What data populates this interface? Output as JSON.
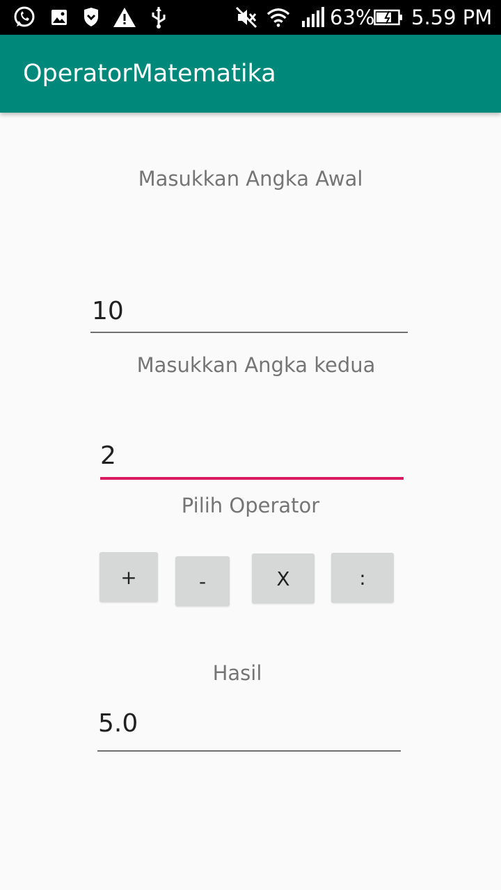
{
  "status_bar": {
    "battery_percent": "63%",
    "time": "5.59 PM",
    "icons": [
      "whatsapp-icon",
      "image-icon",
      "shield-icon",
      "warning-icon",
      "usb-icon",
      "mute-icon",
      "wifi-icon",
      "signal-icon",
      "battery-icon"
    ]
  },
  "app_bar": {
    "title": "OperatorMatematika",
    "color": "#00897b"
  },
  "form": {
    "first_label": "Masukkan Angka Awal",
    "first_value": "10",
    "second_label": "Masukkan Angka kedua",
    "second_value": "2",
    "operator_label": "Pilih Operator",
    "operators": {
      "add": "+",
      "subtract": "-",
      "multiply": "X",
      "divide": ":"
    },
    "result_label": "Hasil",
    "result_value": "5.0"
  },
  "colors": {
    "accent": "#d81b60",
    "button_bg": "#d6d7d7"
  }
}
